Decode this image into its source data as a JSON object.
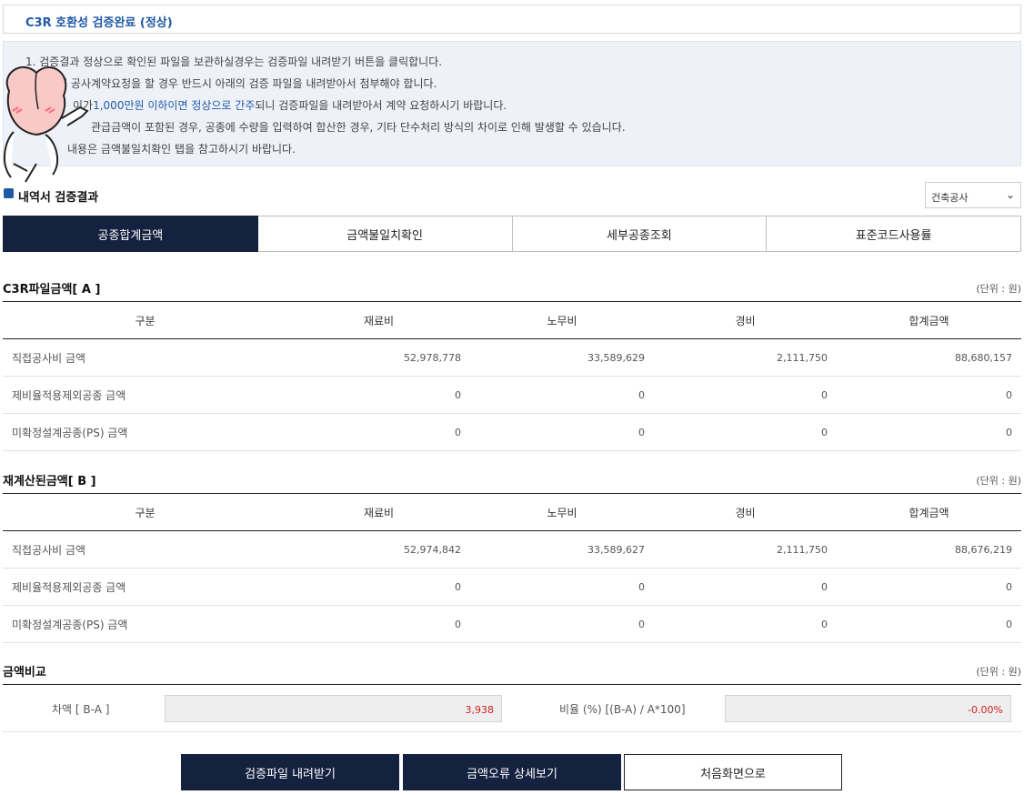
{
  "header": {
    "title": "C3R 호환성 검증완료 (정상)"
  },
  "notice": {
    "lines": [
      "1. 검증결과 정상으로 확인된 파일을 보관하실경우는 검증파일 내려받기 버튼을 클릭합니다.",
      "청에 공사계약요청을 할 경우 반드시 아래의 검증 파일을 내려받아서 첨부해야 합니다.",
      "이가",
      "1,000만원 이하이면 정상으로 간주",
      "되니 검증파일을 내려받아서 계약 요청하시기 바랍니다.",
      "관급금액이 포함된 경우, 공종에 수량을 입력하여 합산한 경우, 기타 단수처리 방식의 차이로 인해 발생할 수 있습니다.",
      "내용은 금액불일치확인 탭을 참고하시기 바랍니다."
    ]
  },
  "result_section": {
    "title": "내역서 검증결과",
    "select_value": "건축공사"
  },
  "tabs": [
    "공종합계금액",
    "금액불일치확인",
    "세부공종조회",
    "표준코드사용률"
  ],
  "columns": [
    "구분",
    "재료비",
    "노무비",
    "경비",
    "합계금액"
  ],
  "unit_label": "(단위 : 원)",
  "table_a": {
    "title": "C3R파일금액[ A ]",
    "rows": [
      {
        "label": "직접공사비 금액",
        "values": [
          "52,978,778",
          "33,589,629",
          "2,111,750",
          "88,680,157"
        ]
      },
      {
        "label": "제비율적용제외공종 금액",
        "values": [
          "0",
          "0",
          "0",
          "0"
        ]
      },
      {
        "label": "미확정설계공종(PS) 금액",
        "values": [
          "0",
          "0",
          "0",
          "0"
        ]
      }
    ]
  },
  "table_b": {
    "title": "재계산된금액[ B ]",
    "rows": [
      {
        "label": "직접공사비 금액",
        "values": [
          "52,974,842",
          "33,589,627",
          "2,111,750",
          "88,676,219"
        ]
      },
      {
        "label": "제비율적용제외공종 금액",
        "values": [
          "0",
          "0",
          "0",
          "0"
        ]
      },
      {
        "label": "미확정설계공종(PS) 금액",
        "values": [
          "0",
          "0",
          "0",
          "0"
        ]
      }
    ]
  },
  "comparison": {
    "title": "금액비교",
    "diff_label": "차액 [ B-A ]",
    "diff_value": "3,938",
    "ratio_label": "비율 (%) [(B-A) / A*100]",
    "ratio_value": "-0.00%",
    "value_color": "#d21f1f"
  },
  "buttons": {
    "download": "검증파일 내려받기",
    "error_detail": "금액오류 상세보기",
    "home": "처음화면으로"
  },
  "colors": {
    "navy": "#14213f",
    "accent_blue": "#1f5aa6",
    "notice_bg": "#eef1f8"
  }
}
